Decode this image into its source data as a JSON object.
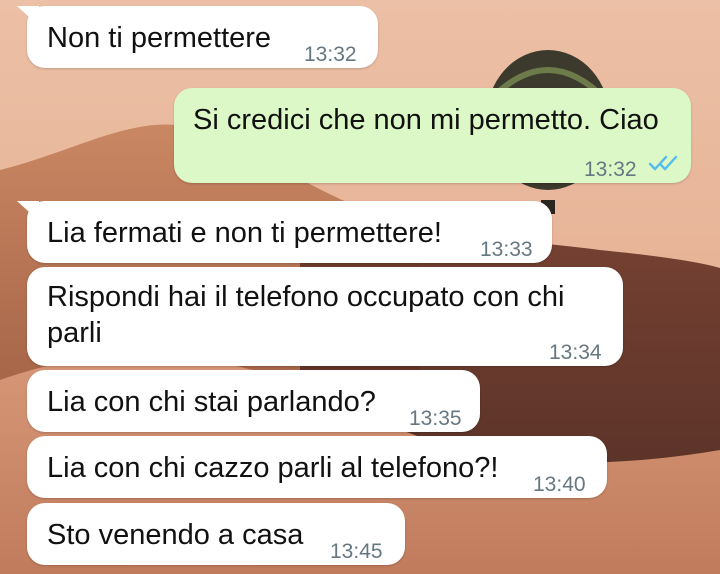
{
  "messages": [
    {
      "direction": "incoming",
      "text": "Non ti permettere",
      "time": "13:32"
    },
    {
      "direction": "outgoing",
      "text": "Si credici che non mi permetto. Ciao",
      "time": "13:32",
      "status": "read",
      "status_icon": "double-check-icon"
    },
    {
      "direction": "incoming",
      "text": "Lia fermati e non ti permettere!",
      "time": "13:33"
    },
    {
      "direction": "incoming",
      "text": "Rispondi hai il telefono occupato con chi parli",
      "time": "13:34"
    },
    {
      "direction": "incoming",
      "text": "Lia con chi stai parlando?",
      "time": "13:35"
    },
    {
      "direction": "incoming",
      "text": "Lia con chi cazzo parli al telefono?!",
      "time": "13:40"
    },
    {
      "direction": "incoming",
      "text": "Sto venendo a casa",
      "time": "13:45"
    }
  ],
  "colors": {
    "incoming_bubble": "#ffffff",
    "outgoing_bubble": "#dcf8c6",
    "read_ticks": "#53bdeb",
    "timestamp": "#667781"
  }
}
